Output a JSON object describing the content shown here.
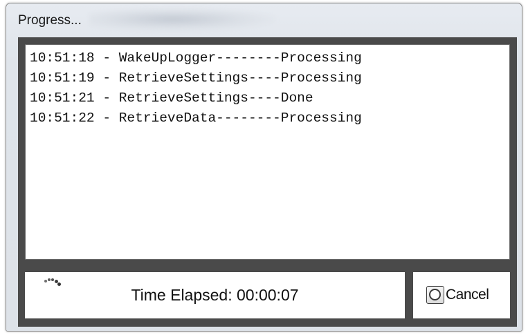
{
  "window": {
    "title": "Progress..."
  },
  "log": {
    "lines": [
      "10:51:18 - WakeUpLogger--------Processing",
      "10:51:19 - RetrieveSettings----Processing",
      "10:51:21 - RetrieveSettings----Done",
      "10:51:22 - RetrieveData--------Processing"
    ]
  },
  "status": {
    "elapsed_text": "Time Elapsed: 00:00:07",
    "spinner_icon": "busy-spinner-icon"
  },
  "actions": {
    "cancel_label": "Cancel",
    "cancel_icon": "cancel-icon"
  },
  "colors": {
    "frame": "#4a4a4a",
    "panel": "#ffffff",
    "window_bg": "#dde2e8"
  }
}
